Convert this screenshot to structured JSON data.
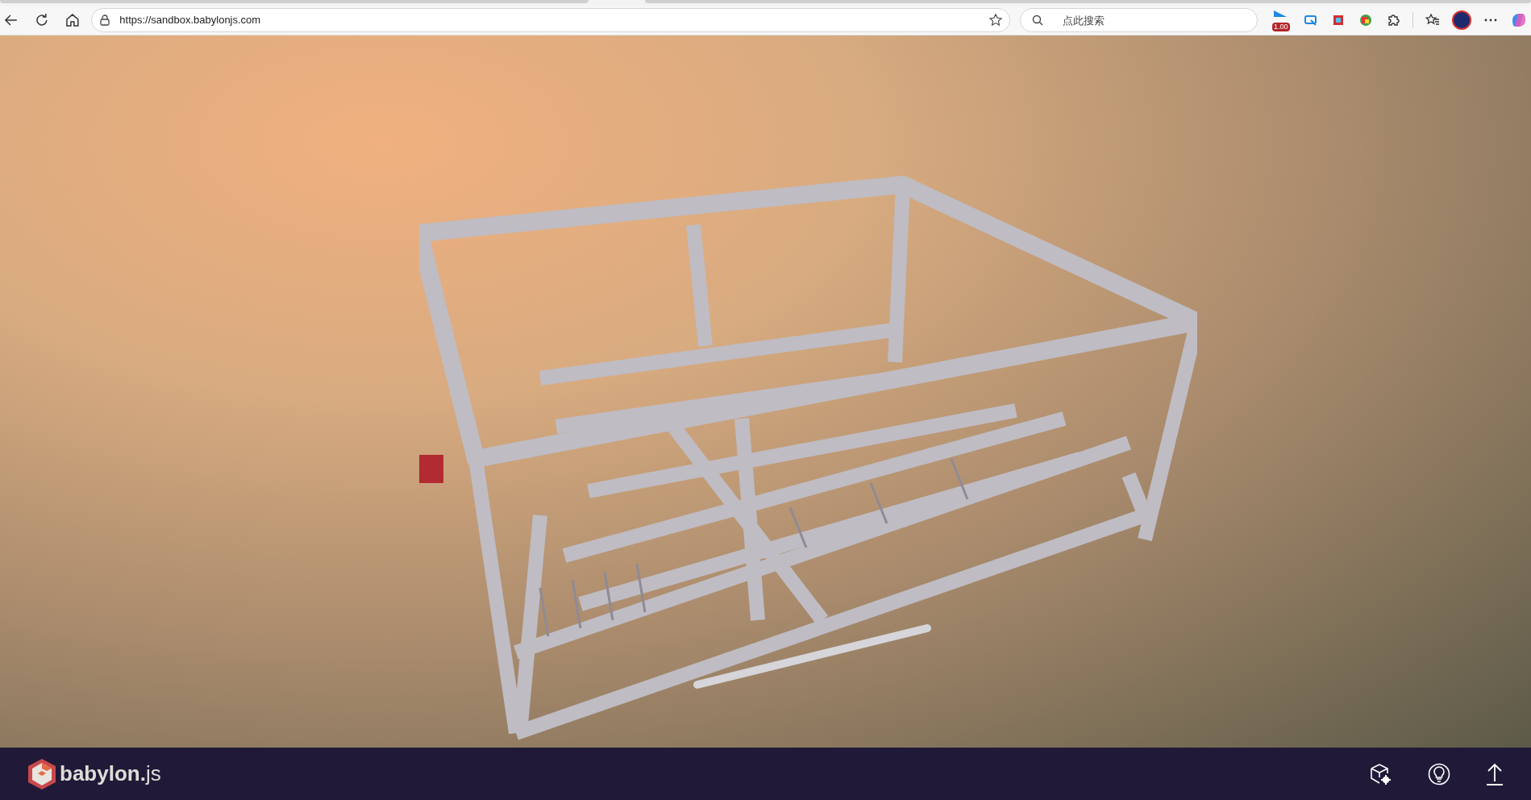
{
  "browser": {
    "url": "https://sandbox.babylonjs.com",
    "search": {
      "placeholder": "点此搜索"
    },
    "extension_badge": "1.00"
  },
  "footer": {
    "logo_text": "**babylon.**js"
  }
}
